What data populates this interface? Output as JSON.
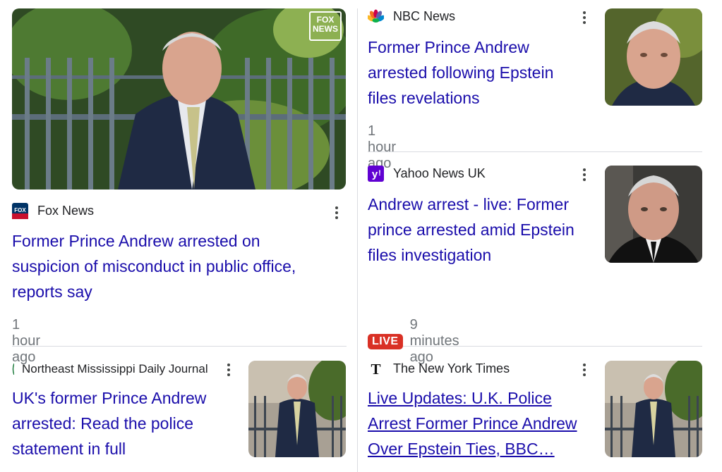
{
  "articles": [
    {
      "source": "Fox News",
      "source_icon": "fox-news-icon",
      "title": "Former Prince Andrew arrested on suspicion of misconduct in public office, reports say",
      "time": "1 hour ago",
      "image_watermark": "FOX NEWS"
    },
    {
      "source": "NBC News",
      "source_icon": "nbc-peacock-icon",
      "title": "Former Prince Andrew arrested following Epstein files revelations",
      "time": "1 hour ago"
    },
    {
      "source": "Yahoo News UK",
      "source_icon": "yahoo-icon",
      "title": "Andrew arrest - live: Former prince arrested amid Epstein files investigation",
      "badge": "LIVE",
      "time": "9 minutes ago"
    },
    {
      "source": "Northeast Mississippi Daily Journal",
      "source_icon": "daily-journal-icon",
      "title": "UK's former Prince Andrew arrested: Read the police statement in full"
    },
    {
      "source": "The New York Times",
      "source_icon": "nyt-icon",
      "title": "Live Updates: U.K. Police Arrest Former Prince Andrew Over Epstein Ties, BBC…"
    }
  ],
  "colors": {
    "title": "#1a0dab",
    "time": "#70757a",
    "live": "#d93025",
    "divider": "#dadce0"
  }
}
